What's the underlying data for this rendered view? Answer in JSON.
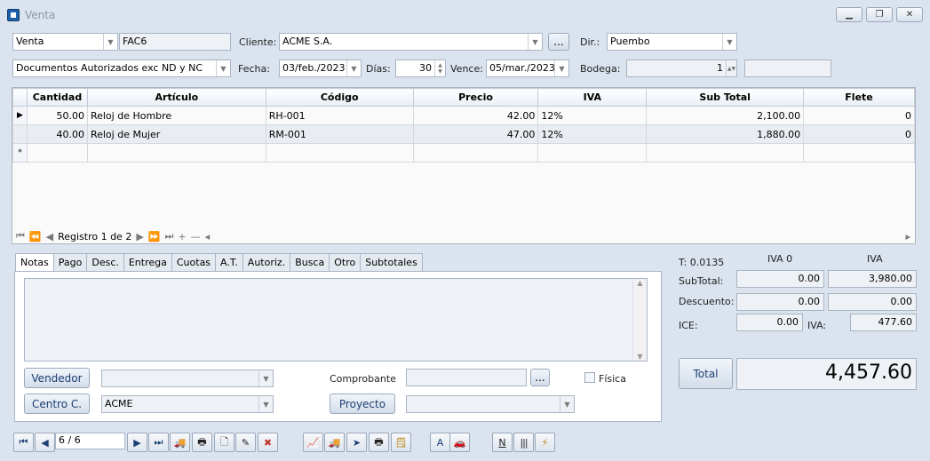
{
  "window": {
    "title": "Venta",
    "minimize_icon": "minimize-icon",
    "restore_icon": "restore-icon",
    "close_icon": "close-icon"
  },
  "header": {
    "doc_type": "Venta",
    "doc_code": "FAC6",
    "cliente_label": "Cliente:",
    "cliente": "ACME S.A.",
    "ellipsis": "...",
    "dir_label": "Dir.:",
    "dir": "Puembo",
    "auth": "Documentos Autorizados exc ND y NC",
    "fecha_label": "Fecha:",
    "fecha": "03/feb./2023",
    "dias_label": "Días:",
    "dias": "30",
    "vence_label": "Vence:",
    "vence": "05/mar./2023",
    "bodega_label": "Bodega:",
    "bodega": "1",
    "extra": ""
  },
  "grid": {
    "columns": [
      "Cantidad",
      "Artículo",
      "Código",
      "Precio",
      "IVA",
      "Sub Total",
      "Flete"
    ],
    "rows": [
      {
        "indicator": "▶",
        "cantidad": "50.00",
        "articulo": "Reloj de Hombre",
        "codigo": "RH-001",
        "precio": "42.00",
        "iva": "12%",
        "subtotal": "2,100.00",
        "flete": "0"
      },
      {
        "indicator": "",
        "cantidad": "40.00",
        "articulo": "Reloj de Mujer",
        "codigo": "RM-001",
        "precio": "47.00",
        "iva": "12%",
        "subtotal": "1,880.00",
        "flete": "0"
      }
    ],
    "new_row_indicator": "*",
    "navigator": {
      "record": "Registro 1 de 2"
    }
  },
  "tabs": [
    "Notas",
    "Pago",
    "Desc.",
    "Entrega",
    "Cuotas",
    "A.T.",
    "Autoriz.",
    "Busca",
    "Otro",
    "Subtotales"
  ],
  "notes": {
    "vendedor_button": "Vendedor",
    "vendedor": "",
    "centro_button": "Centro C.",
    "centro": "ACME",
    "comprobante_label": "Comprobante",
    "comprobante": "",
    "proyecto_button": "Proyecto",
    "proyecto": "",
    "fisica_label": "Física",
    "fisica_checked": false
  },
  "totals": {
    "t_label": "T: 0.0135",
    "iva0_header": "IVA 0",
    "iva_header": "IVA",
    "subtotal_label": "SubTotal:",
    "subtotal_iva0": "0.00",
    "subtotal_iva": "3,980.00",
    "descuento_label": "Descuento:",
    "descuento_iva0": "0.00",
    "descuento_iva": "0.00",
    "ice_label": "ICE:",
    "ice": "0.00",
    "iva_label": "IVA:",
    "iva": "477.60",
    "total_button": "Total",
    "total": "4,457.60"
  },
  "bottom_nav": {
    "record": "6 / 6"
  }
}
